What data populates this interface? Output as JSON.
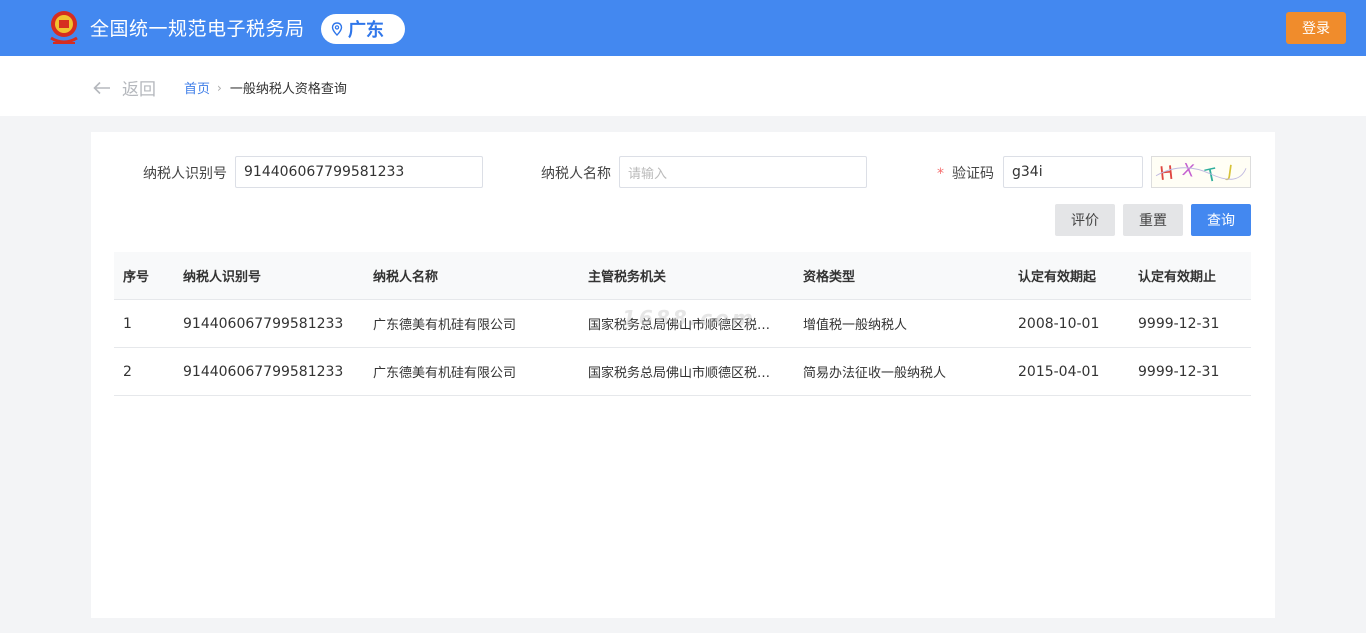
{
  "header": {
    "emblem_icon": "tax-emblem-icon",
    "title": "全国统一规范电子税务局",
    "region": "广东",
    "login_label": "登录",
    "colors": {
      "bar": "#4388f0",
      "login": "#f08c2c"
    }
  },
  "nav": {
    "back_label": "返回",
    "breadcrumb": {
      "home": "首页",
      "current": "一般纳税人资格查询"
    }
  },
  "form": {
    "taxpayer_id": {
      "label": "纳税人识别号",
      "value": "914406067799581233"
    },
    "taxpayer_name": {
      "label": "纳税人名称",
      "placeholder": "请输入"
    },
    "captcha": {
      "required_mark": "*",
      "label": "验证码",
      "value": "g34i",
      "image_text": "HXTJ"
    },
    "buttons": {
      "evaluate": "评价",
      "reset": "重置",
      "query": "查询"
    }
  },
  "table": {
    "columns": [
      "序号",
      "纳税人识别号",
      "纳税人名称",
      "主管税务机关",
      "资格类型",
      "认定有效期起",
      "认定有效期止"
    ],
    "rows": [
      [
        "1",
        "914406067799581233",
        "广东德美有机硅有限公司",
        "国家税务总局佛山市顺德区税…",
        "增值税一般纳税人",
        "2008-10-01",
        "9999-12-31"
      ],
      [
        "2",
        "914406067799581233",
        "广东德美有机硅有限公司",
        "国家税务总局佛山市顺德区税…",
        "简易办法征收一般纳税人",
        "2015-04-01",
        "9999-12-31"
      ]
    ]
  },
  "watermark": "1688.com"
}
